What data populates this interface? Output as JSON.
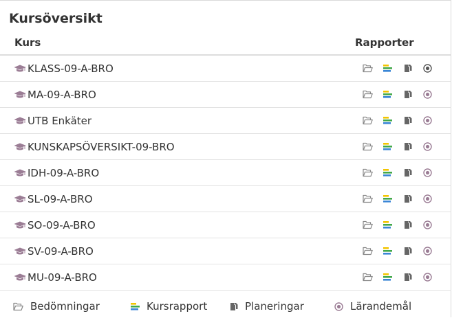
{
  "title": "Kursöversikt",
  "columns": {
    "course": "Kurs",
    "reports": "Rapporter"
  },
  "courses": [
    {
      "name": "KLASS-09-A-BRO"
    },
    {
      "name": "MA-09-A-BRO"
    },
    {
      "name": "UTB Enkäter"
    },
    {
      "name": "KUNSKAPSÖVERSIKT-09-BRO"
    },
    {
      "name": "IDH-09-A-BRO"
    },
    {
      "name": "SL-09-A-BRO"
    },
    {
      "name": "SO-09-A-BRO"
    },
    {
      "name": "SV-09-A-BRO"
    },
    {
      "name": "MU-09-A-BRO"
    }
  ],
  "legend": {
    "assessments": "Bedömningar",
    "course_report": "Kursrapport",
    "plannings": "Planeringar",
    "learning_goals": "Lärandemål"
  },
  "icons": {
    "course": "graduation-cap-icon",
    "assessments": "folder-open-icon",
    "course_report": "report-bars-icon",
    "plannings": "copy-icon",
    "learning_goals": "target-icon"
  },
  "colors": {
    "text": "#333333",
    "cap_icon": "#9b7d95",
    "folder_icon": "#888888",
    "bar_yellow": "#f2c500",
    "bar_green": "#42a84a",
    "bar_blue": "#3a86d6",
    "copy_icon": "#666666",
    "target_icon": "#9b7d95"
  }
}
